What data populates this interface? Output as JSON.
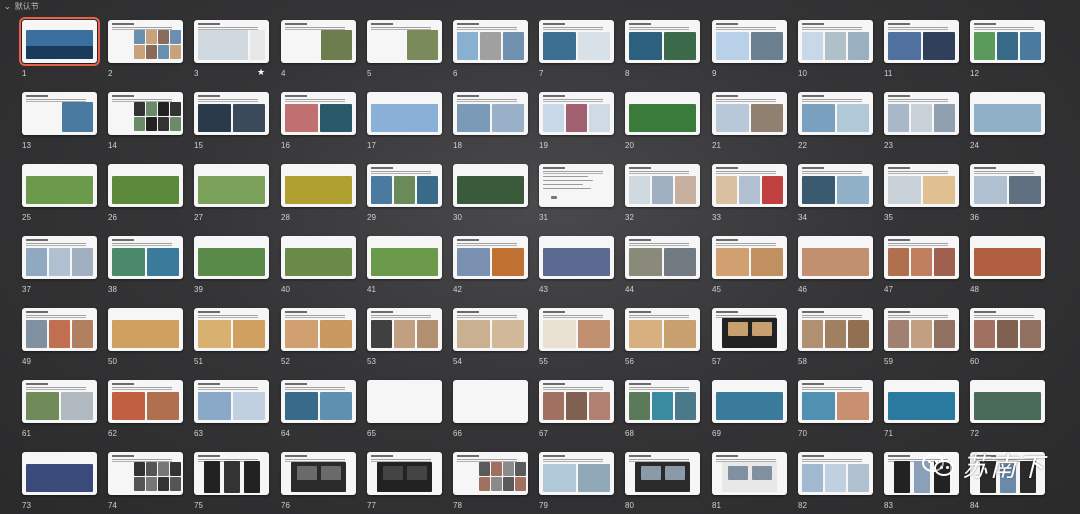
{
  "section": {
    "label": "默认节",
    "chevron_icon": "chevron-down-icon"
  },
  "starred_slide": 3,
  "selected_slide": 1,
  "watermark": {
    "text": "苏南下",
    "icon": "wechat-icon"
  },
  "slides": [
    {
      "n": "1",
      "tpl": "cover",
      "c": [
        "#3a6fa0",
        "#1b3b5a"
      ]
    },
    {
      "n": "2",
      "tpl": "grid",
      "c": [
        "#6a8fb0",
        "#c7a27a",
        "#8a6a5a"
      ]
    },
    {
      "n": "3",
      "tpl": "map",
      "c": [
        "#e8e8e8",
        "#d0d8e0"
      ]
    },
    {
      "n": "4",
      "tpl": "textimg",
      "c": [
        "#6d7d4e"
      ]
    },
    {
      "n": "5",
      "tpl": "textimg",
      "c": [
        "#7a8a5a"
      ]
    },
    {
      "n": "6",
      "tpl": "three",
      "c": [
        "#8ab0d0",
        "#a0a0a0",
        "#7090b0"
      ]
    },
    {
      "n": "7",
      "tpl": "two",
      "c": [
        "#3a6f8f",
        "#d8e0e8"
      ]
    },
    {
      "n": "8",
      "tpl": "two",
      "c": [
        "#2d5f7f",
        "#3a6a4a"
      ]
    },
    {
      "n": "9",
      "tpl": "two",
      "c": [
        "#b8d0e8",
        "#6a8090"
      ]
    },
    {
      "n": "10",
      "tpl": "three",
      "c": [
        "#c8d8e8",
        "#b0c0c8",
        "#9ab0c0"
      ]
    },
    {
      "n": "11",
      "tpl": "two",
      "c": [
        "#5070a0",
        "#30405a"
      ]
    },
    {
      "n": "12",
      "tpl": "three",
      "c": [
        "#5a9a5a",
        "#3a6a8a",
        "#4a7aa0"
      ]
    },
    {
      "n": "13",
      "tpl": "textimg",
      "c": [
        "#4a7aa0"
      ]
    },
    {
      "n": "14",
      "tpl": "grid",
      "c": [
        "#333",
        "#6a8a6a",
        "#222"
      ]
    },
    {
      "n": "15",
      "tpl": "two",
      "c": [
        "#2a3a4a",
        "#3a4a5a"
      ]
    },
    {
      "n": "16",
      "tpl": "two",
      "c": [
        "#c07070",
        "#2a5a6a"
      ]
    },
    {
      "n": "17",
      "tpl": "full",
      "c": [
        "#8ab0d8"
      ]
    },
    {
      "n": "18",
      "tpl": "two",
      "c": [
        "#7a9ab8",
        "#9ab0c8"
      ]
    },
    {
      "n": "19",
      "tpl": "three",
      "c": [
        "#c8d8e8",
        "#a06070",
        "#d0dae4"
      ]
    },
    {
      "n": "20",
      "tpl": "full",
      "c": [
        "#3a7a3a"
      ]
    },
    {
      "n": "21",
      "tpl": "two",
      "c": [
        "#b8c8d8",
        "#908070"
      ]
    },
    {
      "n": "22",
      "tpl": "two",
      "c": [
        "#7aa0c0",
        "#b0c8d8"
      ]
    },
    {
      "n": "23",
      "tpl": "three",
      "c": [
        "#a8b8c8",
        "#c8d0d8",
        "#90a0b0"
      ]
    },
    {
      "n": "24",
      "tpl": "full",
      "c": [
        "#90b0c8"
      ]
    },
    {
      "n": "25",
      "tpl": "full",
      "c": [
        "#6a9a4a"
      ]
    },
    {
      "n": "26",
      "tpl": "full",
      "c": [
        "#5a8a3a"
      ]
    },
    {
      "n": "27",
      "tpl": "full",
      "c": [
        "#7aa05a"
      ]
    },
    {
      "n": "28",
      "tpl": "full",
      "c": [
        "#b0a030"
      ]
    },
    {
      "n": "29",
      "tpl": "three",
      "c": [
        "#4a7aa0",
        "#6a8a5a",
        "#3a6a8a"
      ]
    },
    {
      "n": "30",
      "tpl": "full",
      "c": [
        "#3a5a3a"
      ]
    },
    {
      "n": "31",
      "tpl": "text",
      "c": [
        "#f6f6f6"
      ]
    },
    {
      "n": "32",
      "tpl": "three",
      "c": [
        "#d0d8e0",
        "#a0b0c0",
        "#c8b0a0"
      ]
    },
    {
      "n": "33",
      "tpl": "three",
      "c": [
        "#d8c0a0",
        "#b0c0d0",
        "#c04040"
      ]
    },
    {
      "n": "34",
      "tpl": "two",
      "c": [
        "#3a5a70",
        "#90b0c8"
      ]
    },
    {
      "n": "35",
      "tpl": "two",
      "c": [
        "#c8d0d8",
        "#e0c090"
      ]
    },
    {
      "n": "36",
      "tpl": "two",
      "c": [
        "#b0c0d0",
        "#607080"
      ]
    },
    {
      "n": "37",
      "tpl": "three",
      "c": [
        "#90a8c0",
        "#b0c0d0",
        "#a0b0c0"
      ]
    },
    {
      "n": "38",
      "tpl": "two",
      "c": [
        "#4a8a6a",
        "#3a7a9a"
      ]
    },
    {
      "n": "39",
      "tpl": "full",
      "c": [
        "#5a8a4a"
      ]
    },
    {
      "n": "40",
      "tpl": "full",
      "c": [
        "#6a8a4a"
      ]
    },
    {
      "n": "41",
      "tpl": "full",
      "c": [
        "#6a9a4a"
      ]
    },
    {
      "n": "42",
      "tpl": "two",
      "c": [
        "#7a90b0",
        "#c07030"
      ]
    },
    {
      "n": "43",
      "tpl": "full",
      "c": [
        "#5a6a90"
      ]
    },
    {
      "n": "44",
      "tpl": "two",
      "c": [
        "#8a8a7a",
        "#707a80"
      ]
    },
    {
      "n": "45",
      "tpl": "two",
      "c": [
        "#d0a070",
        "#c09060"
      ]
    },
    {
      "n": "46",
      "tpl": "full",
      "c": [
        "#c09070"
      ]
    },
    {
      "n": "47",
      "tpl": "three",
      "c": [
        "#b07050",
        "#c08060",
        "#a06050"
      ]
    },
    {
      "n": "48",
      "tpl": "full",
      "c": [
        "#b06040"
      ]
    },
    {
      "n": "49",
      "tpl": "three",
      "c": [
        "#8090a0",
        "#c07050",
        "#b08060"
      ]
    },
    {
      "n": "50",
      "tpl": "full",
      "c": [
        "#d0a060"
      ]
    },
    {
      "n": "51",
      "tpl": "two",
      "c": [
        "#d8b070",
        "#d0a060"
      ]
    },
    {
      "n": "52",
      "tpl": "two",
      "c": [
        "#d0a070",
        "#c89860"
      ]
    },
    {
      "n": "53",
      "tpl": "three",
      "c": [
        "#404040",
        "#c0a080",
        "#b09070"
      ]
    },
    {
      "n": "54",
      "tpl": "two",
      "c": [
        "#c8b090",
        "#d0b898"
      ]
    },
    {
      "n": "55",
      "tpl": "two",
      "c": [
        "#e8e0d0",
        "#c09070"
      ]
    },
    {
      "n": "56",
      "tpl": "two",
      "c": [
        "#d8b080",
        "#c8a070"
      ]
    },
    {
      "n": "57",
      "tpl": "dark",
      "c": [
        "#222",
        "#c8a070"
      ]
    },
    {
      "n": "58",
      "tpl": "three",
      "c": [
        "#b09070",
        "#a08060",
        "#907050"
      ]
    },
    {
      "n": "59",
      "tpl": "three",
      "c": [
        "#a08070",
        "#c0a080",
        "#907060"
      ]
    },
    {
      "n": "60",
      "tpl": "three",
      "c": [
        "#a07060",
        "#806050",
        "#907060"
      ]
    },
    {
      "n": "61",
      "tpl": "two",
      "c": [
        "#708a5a",
        "#b0b8c0"
      ]
    },
    {
      "n": "62",
      "tpl": "two",
      "c": [
        "#c06040",
        "#b07050"
      ]
    },
    {
      "n": "63",
      "tpl": "two",
      "c": [
        "#8aa8c8",
        "#c0d0e0"
      ]
    },
    {
      "n": "64",
      "tpl": "two",
      "c": [
        "#3a6a8a",
        "#6090b0"
      ]
    },
    {
      "n": "65",
      "tpl": "blank",
      "c": [
        "#ffffff"
      ]
    },
    {
      "n": "66",
      "tpl": "blank",
      "c": [
        "#ffffff"
      ]
    },
    {
      "n": "67",
      "tpl": "three",
      "c": [
        "#a07060",
        "#806050",
        "#b08070"
      ]
    },
    {
      "n": "68",
      "tpl": "three",
      "c": [
        "#5a7a5a",
        "#3a8aa0",
        "#4a7a8a"
      ]
    },
    {
      "n": "69",
      "tpl": "full",
      "c": [
        "#3a7a9a"
      ]
    },
    {
      "n": "70",
      "tpl": "two",
      "c": [
        "#5090b0",
        "#c89070"
      ]
    },
    {
      "n": "71",
      "tpl": "full",
      "c": [
        "#2a7aa0"
      ]
    },
    {
      "n": "72",
      "tpl": "full",
      "c": [
        "#4a6a5a"
      ]
    },
    {
      "n": "73",
      "tpl": "full",
      "c": [
        "#3a4a7a"
      ]
    },
    {
      "n": "74",
      "tpl": "grid",
      "c": [
        "#333",
        "#555",
        "#777"
      ]
    },
    {
      "n": "75",
      "tpl": "phone",
      "c": [
        "#222",
        "#333"
      ]
    },
    {
      "n": "76",
      "tpl": "dark",
      "c": [
        "#2a2a2a",
        "#6a6a6a"
      ]
    },
    {
      "n": "77",
      "tpl": "dark",
      "c": [
        "#222",
        "#444"
      ]
    },
    {
      "n": "78",
      "tpl": "grid",
      "c": [
        "#5a5a5a",
        "#a07060",
        "#8a8a8a"
      ]
    },
    {
      "n": "79",
      "tpl": "two",
      "c": [
        "#b0c8d8",
        "#90a8b8"
      ]
    },
    {
      "n": "80",
      "tpl": "dark",
      "c": [
        "#2a2a2a",
        "#8a9aa8"
      ]
    },
    {
      "n": "81",
      "tpl": "dark",
      "c": [
        "#e8e8e8",
        "#8090a0"
      ]
    },
    {
      "n": "82",
      "tpl": "three",
      "c": [
        "#a0b8d0",
        "#c0d0e0",
        "#b0c0d0"
      ]
    },
    {
      "n": "83",
      "tpl": "phone",
      "c": [
        "#222",
        "#8aa0b8"
      ]
    },
    {
      "n": "84",
      "tpl": "phone",
      "c": [
        "#2a2a2a",
        "#6a8aa8"
      ]
    }
  ]
}
